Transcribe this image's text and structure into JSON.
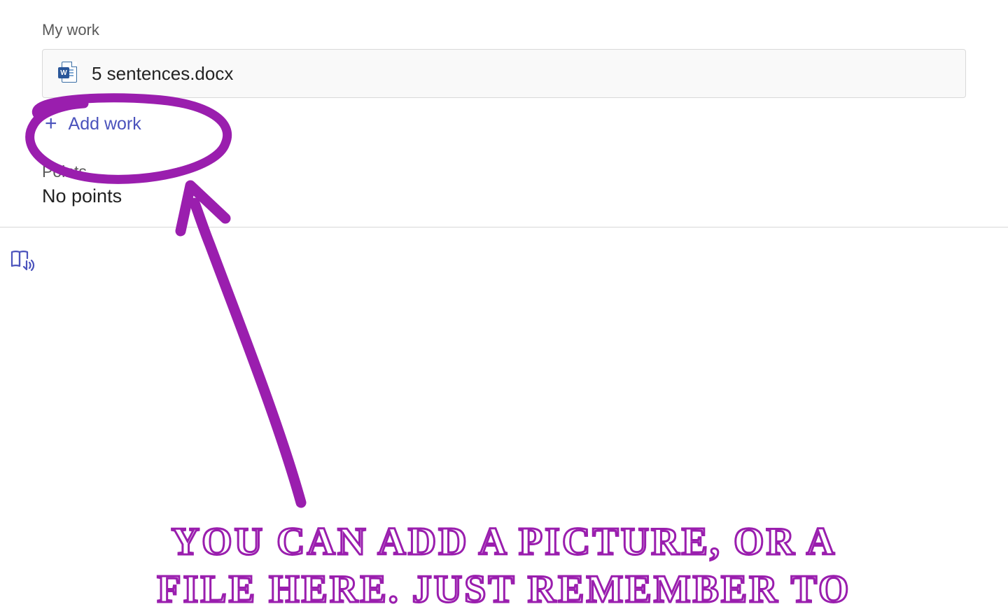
{
  "section": {
    "my_work_label": "My work",
    "file": {
      "name": "5 sentences.docx",
      "icon_badge": "W"
    },
    "add_work_label": "Add work",
    "points_label": "Points",
    "points_value": "No points"
  },
  "annotation": {
    "line1": "YOU CAN ADD A PICTURE, OR A",
    "line2": "FILE HERE.  JUST REMEMBER TO",
    "color": "#9a1eae"
  }
}
